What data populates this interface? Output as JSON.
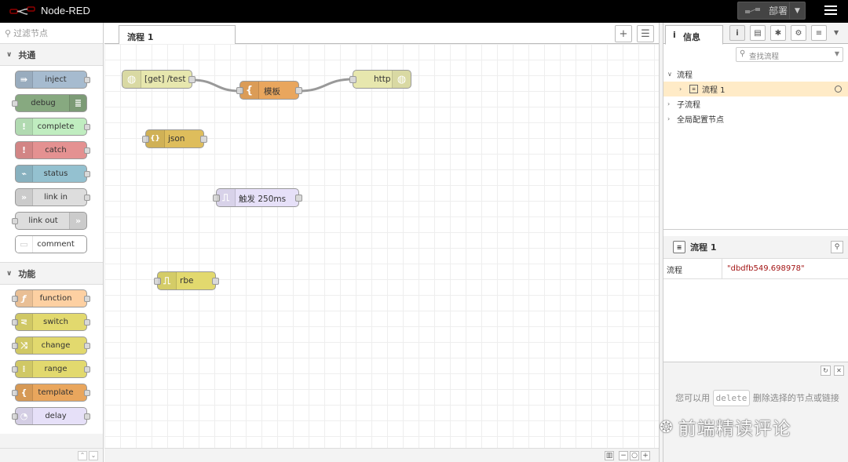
{
  "header": {
    "title": "Node-RED",
    "deploy_label": "部署"
  },
  "palette": {
    "search_placeholder": "过滤节点",
    "categories": [
      {
        "name": "共通",
        "nodes": [
          "inject",
          "debug",
          "complete",
          "catch",
          "status",
          "link in",
          "link out",
          "comment"
        ]
      },
      {
        "name": "功能",
        "nodes": [
          "function",
          "switch",
          "change",
          "range",
          "template",
          "delay"
        ]
      }
    ]
  },
  "workspace": {
    "tab_label": "流程 1",
    "nodes": {
      "get_test": "[get] /test",
      "template": "模板",
      "http": "http",
      "json": "json",
      "trigger": "触发 250ms",
      "rbe": "rbe"
    }
  },
  "sidebar": {
    "tab_label": "信息",
    "search_placeholder": "查找流程",
    "tree": {
      "flows": "流程",
      "flow1": "流程 1",
      "subflows": "子流程",
      "global_config": "全局配置节点"
    },
    "props_title": "流程 1",
    "prop_key": "流程",
    "prop_value": "\"dbdfb549.698978\"",
    "help_prefix": "您可以用",
    "help_key": "delete",
    "help_suffix": "删除选择的节点或链接"
  },
  "watermark": "前端精读评论",
  "colors": {
    "inject": "#a6bbcf",
    "debug": "#87a980",
    "complete": "#c0edc0",
    "catch": "#e49191",
    "status": "#94c1d0",
    "link": "#dddddd",
    "comment": "#ffffff",
    "function": "#fdd0a2",
    "switch": "#e2d96e",
    "change": "#e2d96e",
    "range": "#e2d96e",
    "template": "#e9a65d",
    "delay": "#e6e0f8",
    "http_in": "#e7e7ae",
    "json": "#debd5c",
    "trigger": "#e6e0f8",
    "rbe": "#e2d96e",
    "selection": "#ffebc7",
    "wire": "#999999"
  }
}
